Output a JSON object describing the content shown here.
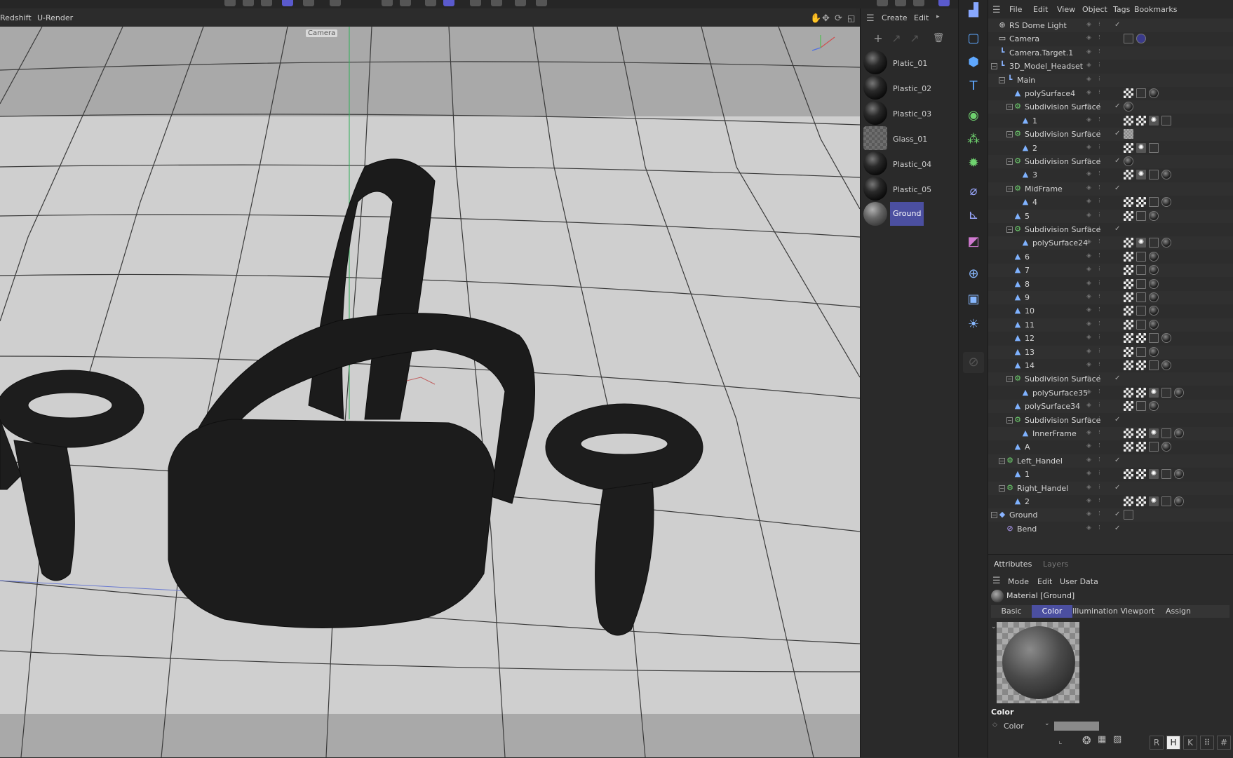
{
  "top_menus": {
    "redshift": "Redshift",
    "urender": "U-Render"
  },
  "viewport": {
    "camera_label": "Camera"
  },
  "material_manager": {
    "menu": {
      "create": "Create",
      "edit": "Edit"
    },
    "materials": [
      {
        "name": "Platic_01",
        "type": "plastic"
      },
      {
        "name": "Plastic_02",
        "type": "plastic"
      },
      {
        "name": "Plastic_03",
        "type": "plastic"
      },
      {
        "name": "Glass_01",
        "type": "glass"
      },
      {
        "name": "Plastic_04",
        "type": "plastic"
      },
      {
        "name": "Plastic_05",
        "type": "plastic"
      },
      {
        "name": "Ground",
        "type": "ground",
        "selected": true
      }
    ]
  },
  "object_manager": {
    "menu": {
      "file": "File",
      "edit": "Edit",
      "view": "View",
      "object": "Object",
      "tags": "Tags",
      "bookmarks": "Bookmarks"
    },
    "tree": [
      {
        "name": "RS Dome Light",
        "depth": 0,
        "icon": "globe",
        "exp": "",
        "chk": "✓",
        "tags": []
      },
      {
        "name": "Camera",
        "depth": 0,
        "icon": "camera",
        "exp": "",
        "chk": "",
        "tags": [
          "target",
          "dot"
        ]
      },
      {
        "name": "Camera.Target.1",
        "depth": 0,
        "icon": "null",
        "exp": "",
        "chk": "",
        "tags": []
      },
      {
        "name": "3D_Model_Headset",
        "depth": 0,
        "icon": "null",
        "exp": "−",
        "chk": "",
        "tags": []
      },
      {
        "name": "Main",
        "depth": 1,
        "icon": "null",
        "exp": "−",
        "chk": "",
        "tags": []
      },
      {
        "name": "polySurface4",
        "depth": 2,
        "icon": "poly",
        "exp": "",
        "chk": "",
        "tags": [
          "checker",
          "uvw",
          "mat"
        ]
      },
      {
        "name": "Subdivision Surface",
        "depth": 2,
        "icon": "subd",
        "exp": "−",
        "chk": "✓",
        "tags": [
          "mat"
        ]
      },
      {
        "name": "1",
        "depth": 3,
        "icon": "poly",
        "exp": "",
        "chk": "",
        "tags": [
          "checker",
          "checker",
          "phong",
          "uvw"
        ]
      },
      {
        "name": "Subdivision Surface",
        "depth": 2,
        "icon": "subd",
        "exp": "−",
        "chk": "✓",
        "tags": [
          "glasst"
        ]
      },
      {
        "name": "2",
        "depth": 3,
        "icon": "poly",
        "exp": "",
        "chk": "",
        "tags": [
          "checker",
          "phong",
          "uvw"
        ]
      },
      {
        "name": "Subdivision Surface",
        "depth": 2,
        "icon": "subd",
        "exp": "−",
        "chk": "✓",
        "tags": [
          "mat"
        ]
      },
      {
        "name": "3",
        "depth": 3,
        "icon": "poly",
        "exp": "",
        "chk": "",
        "tags": [
          "checker",
          "phong",
          "uvw",
          "mat"
        ]
      },
      {
        "name": "MidFrame",
        "depth": 2,
        "icon": "subd",
        "exp": "−",
        "chk": "✓",
        "tags": []
      },
      {
        "name": "4",
        "depth": 3,
        "icon": "poly",
        "exp": "",
        "chk": "",
        "tags": [
          "checker",
          "checker",
          "uvw",
          "mat"
        ]
      },
      {
        "name": "5",
        "depth": 2,
        "icon": "poly",
        "exp": "",
        "chk": "",
        "tags": [
          "checker",
          "uvw",
          "mat"
        ]
      },
      {
        "name": "Subdivision Surface",
        "depth": 2,
        "icon": "subd",
        "exp": "−",
        "chk": "✓",
        "tags": []
      },
      {
        "name": "polySurface24",
        "depth": 3,
        "icon": "poly",
        "exp": "",
        "chk": "",
        "tags": [
          "checker",
          "phong",
          "uvw",
          "mat"
        ]
      },
      {
        "name": "6",
        "depth": 2,
        "icon": "poly",
        "exp": "",
        "chk": "",
        "tags": [
          "checker",
          "uvw",
          "mat"
        ]
      },
      {
        "name": "7",
        "depth": 2,
        "icon": "poly",
        "exp": "",
        "chk": "",
        "tags": [
          "checker",
          "uvw",
          "mat"
        ]
      },
      {
        "name": "8",
        "depth": 2,
        "icon": "poly",
        "exp": "",
        "chk": "",
        "tags": [
          "checker",
          "uvw",
          "mat"
        ]
      },
      {
        "name": "9",
        "depth": 2,
        "icon": "poly",
        "exp": "",
        "chk": "",
        "tags": [
          "checker",
          "uvw",
          "mat"
        ]
      },
      {
        "name": "10",
        "depth": 2,
        "icon": "poly",
        "exp": "",
        "chk": "",
        "tags": [
          "checker",
          "uvw",
          "mat"
        ]
      },
      {
        "name": "11",
        "depth": 2,
        "icon": "poly",
        "exp": "",
        "chk": "",
        "tags": [
          "checker",
          "uvw",
          "mat"
        ]
      },
      {
        "name": "12",
        "depth": 2,
        "icon": "poly",
        "exp": "",
        "chk": "",
        "tags": [
          "checker",
          "checker",
          "uvw",
          "mat"
        ]
      },
      {
        "name": "13",
        "depth": 2,
        "icon": "poly",
        "exp": "",
        "chk": "",
        "tags": [
          "checker",
          "uvw",
          "mat"
        ]
      },
      {
        "name": "14",
        "depth": 2,
        "icon": "poly",
        "exp": "",
        "chk": "",
        "tags": [
          "checker",
          "checker",
          "uvw",
          "mat"
        ]
      },
      {
        "name": "Subdivision Surface",
        "depth": 2,
        "icon": "subd",
        "exp": "−",
        "chk": "✓",
        "tags": []
      },
      {
        "name": "polySurface35",
        "depth": 3,
        "icon": "poly",
        "exp": "",
        "chk": "",
        "tags": [
          "checker",
          "checker",
          "phong",
          "uvw",
          "mat"
        ]
      },
      {
        "name": "polySurface34",
        "depth": 2,
        "icon": "poly",
        "exp": "",
        "chk": "",
        "tags": [
          "checker",
          "uvw",
          "mat"
        ]
      },
      {
        "name": "Subdivision Surface",
        "depth": 2,
        "icon": "subd",
        "exp": "−",
        "chk": "✓",
        "tags": []
      },
      {
        "name": "InnerFrame",
        "depth": 3,
        "icon": "poly",
        "exp": "",
        "chk": "",
        "tags": [
          "checker",
          "checker",
          "phong",
          "uvw",
          "mat"
        ]
      },
      {
        "name": "A",
        "depth": 2,
        "icon": "poly",
        "exp": "",
        "chk": "",
        "tags": [
          "checker",
          "checker",
          "uvw",
          "mat"
        ]
      },
      {
        "name": "Left_Handel",
        "depth": 1,
        "icon": "subd",
        "exp": "−",
        "chk": "✓",
        "tags": []
      },
      {
        "name": "1",
        "depth": 2,
        "icon": "poly",
        "exp": "",
        "chk": "",
        "tags": [
          "checker",
          "checker",
          "phong",
          "uvw",
          "mat"
        ]
      },
      {
        "name": "Right_Handel",
        "depth": 1,
        "icon": "subd",
        "exp": "−",
        "chk": "✓",
        "tags": []
      },
      {
        "name": "2",
        "depth": 2,
        "icon": "poly",
        "exp": "",
        "chk": "",
        "tags": [
          "checker",
          "checker",
          "phong",
          "uvw",
          "mat"
        ]
      },
      {
        "name": "Ground",
        "depth": 0,
        "icon": "plane",
        "exp": "−",
        "chk": "✓",
        "tags": [
          "uvw"
        ]
      },
      {
        "name": "Bend",
        "depth": 1,
        "icon": "bend",
        "exp": "",
        "chk": "✓",
        "tags": []
      }
    ]
  },
  "attributes": {
    "tabs": {
      "attributes": "Attributes",
      "layers": "Layers"
    },
    "menu": {
      "mode": "Mode",
      "edit": "Edit",
      "user_data": "User Data"
    },
    "title": "Material [Ground]",
    "subtabs": [
      "Basic",
      "Color",
      "Illumination",
      "Viewport",
      "Assign"
    ],
    "active_subtab": "Color",
    "section": "Color",
    "param_label": "Color",
    "bottom_icons": [
      "R",
      "H",
      "K",
      "#"
    ]
  },
  "colors": {
    "accent": "#4b4fa0",
    "viewport_floor": "#cfcfcf",
    "panel_bg": "#2d2d2d"
  }
}
